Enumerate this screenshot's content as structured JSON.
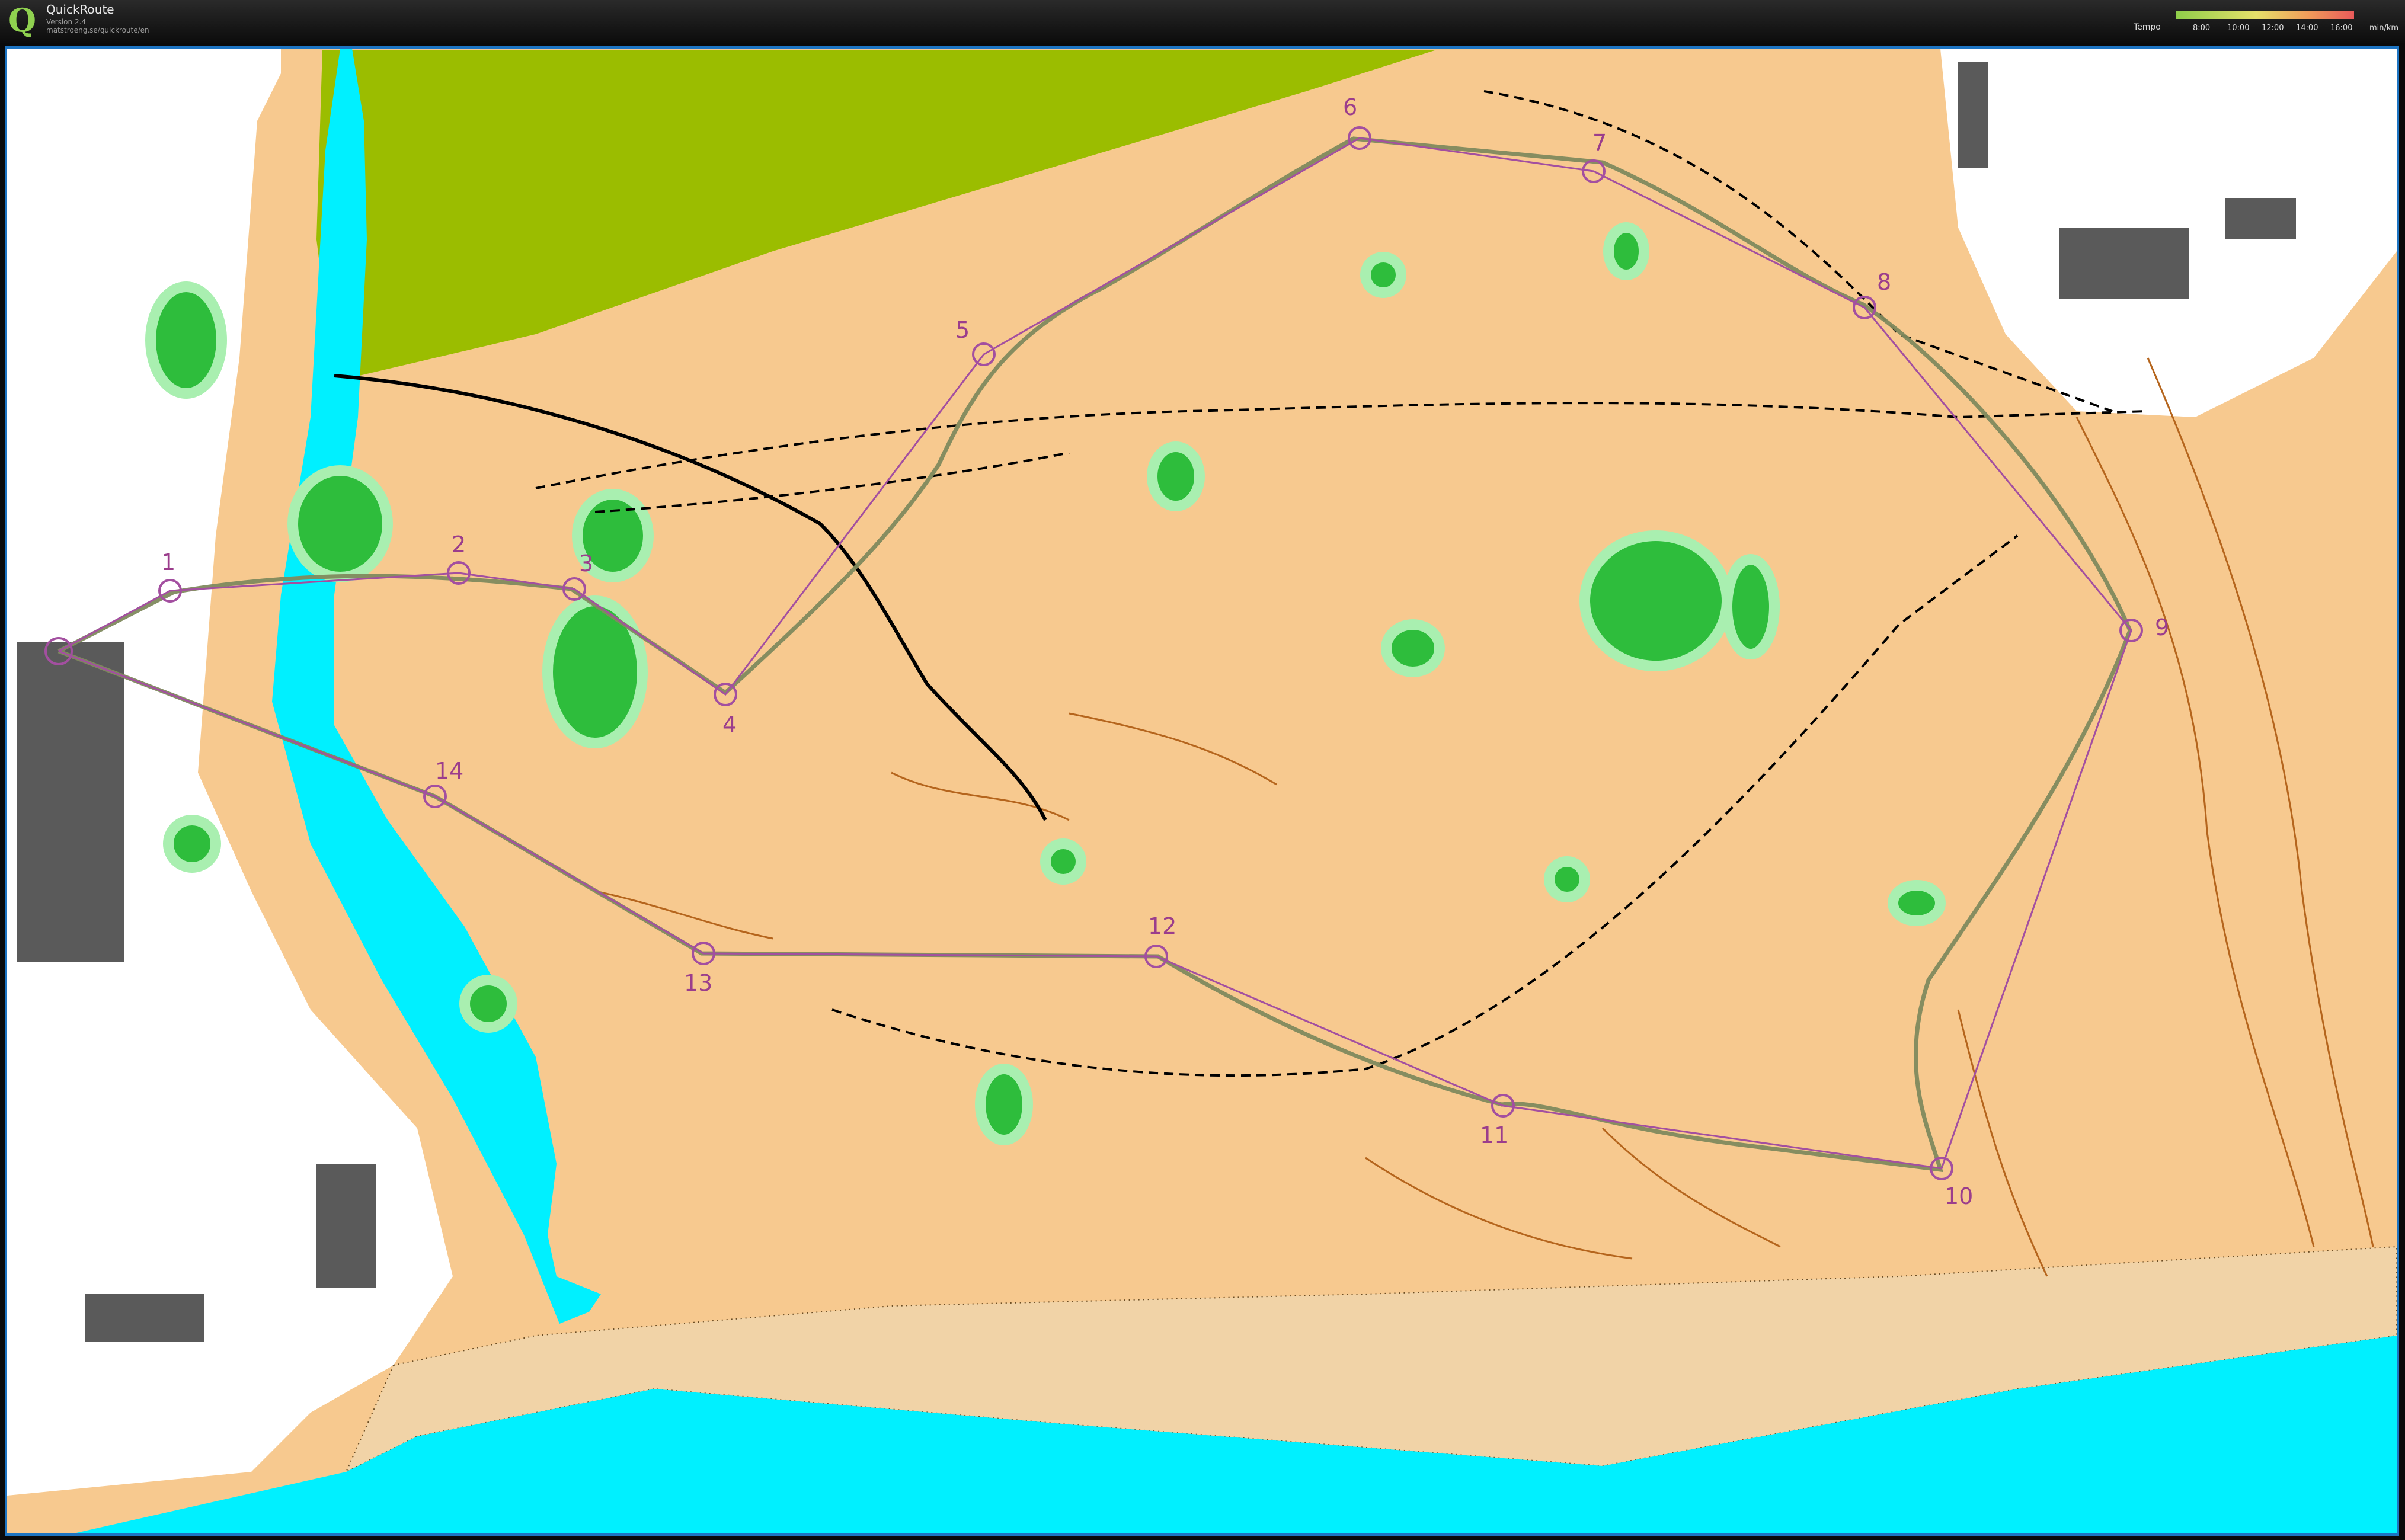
{
  "app": {
    "name": "QuickRoute",
    "version": "Version 2.4",
    "url": "matstroeng.se/quickroute/en"
  },
  "legend": {
    "label": "Tempo",
    "unit": "min/km",
    "ticks": [
      "8:00",
      "10:00",
      "12:00",
      "14:00",
      "16:00"
    ]
  },
  "colors": {
    "open_land": "#f7c98f",
    "forest_green": "#2ebd3c",
    "light_green": "#a9efb0",
    "water": "#00f0ff",
    "olive": "#9bbd00",
    "contour": "#b5651d",
    "course": "#a34fa0",
    "route": "#7f8a5e",
    "frame": "#1d74c2"
  },
  "course": {
    "controls": [
      {
        "label": "1"
      },
      {
        "label": "2"
      },
      {
        "label": "3"
      },
      {
        "label": "4"
      },
      {
        "label": "5"
      },
      {
        "label": "6"
      },
      {
        "label": "7"
      },
      {
        "label": "8"
      },
      {
        "label": "9"
      },
      {
        "label": "10"
      },
      {
        "label": "11"
      },
      {
        "label": "12"
      },
      {
        "label": "13"
      },
      {
        "label": "14"
      }
    ]
  }
}
